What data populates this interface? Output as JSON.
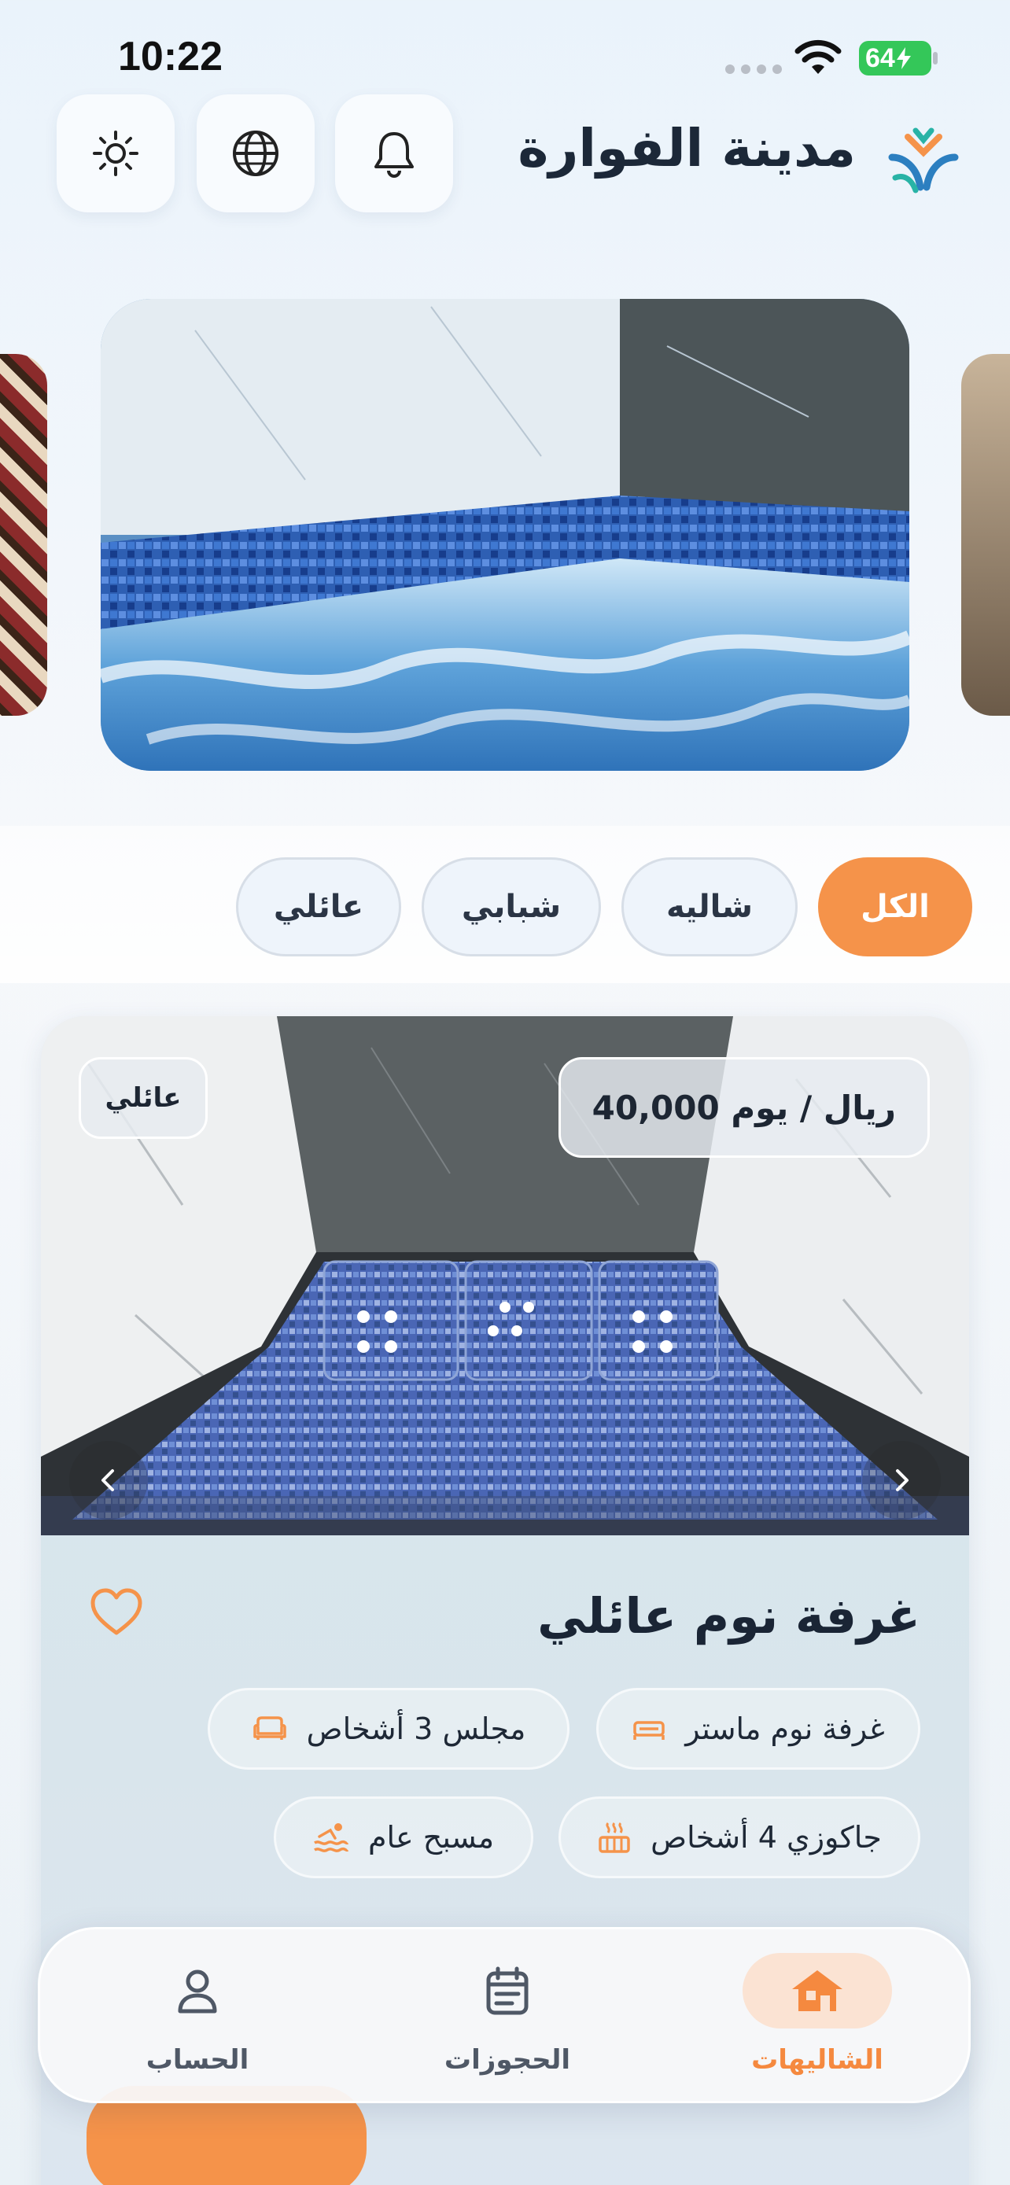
{
  "status_bar": {
    "time": "10:22",
    "battery": "64"
  },
  "header": {
    "title": "مدينة الفوارة",
    "logo_icon": "brand-logo",
    "buttons": [
      {
        "name": "notifications",
        "icon": "bell-icon"
      },
      {
        "name": "language",
        "icon": "globe-icon"
      },
      {
        "name": "theme",
        "icon": "sun-icon"
      }
    ]
  },
  "carousel": {
    "current_slide": "jacuzzi-pool"
  },
  "filters": {
    "items": [
      "الكل",
      "شاليه",
      "شبابي",
      "عائلي"
    ],
    "active": "الكل"
  },
  "card": {
    "price": "40,000 ريال / يوم",
    "type": "عائلي",
    "title": "غرفة نوم عائلي",
    "features": [
      {
        "label": "غرفة نوم ماستر",
        "icon": "bed-icon"
      },
      {
        "label": "مجلس 3 أشخاص",
        "icon": "sofa-icon"
      },
      {
        "label": "جاكوزي 4 أشخاص",
        "icon": "hot-tub-icon"
      },
      {
        "label": "مسبح عام",
        "icon": "swimming-icon"
      }
    ]
  },
  "tabbar": {
    "items": [
      {
        "label": "الشاليهات",
        "icon": "home-icon",
        "active": true
      },
      {
        "label": "الحجوزات",
        "icon": "calendar-icon",
        "active": false
      },
      {
        "label": "الحساب",
        "icon": "user-icon",
        "active": false
      }
    ]
  },
  "colors": {
    "accent": "#f5934a",
    "text": "#1c2838"
  }
}
